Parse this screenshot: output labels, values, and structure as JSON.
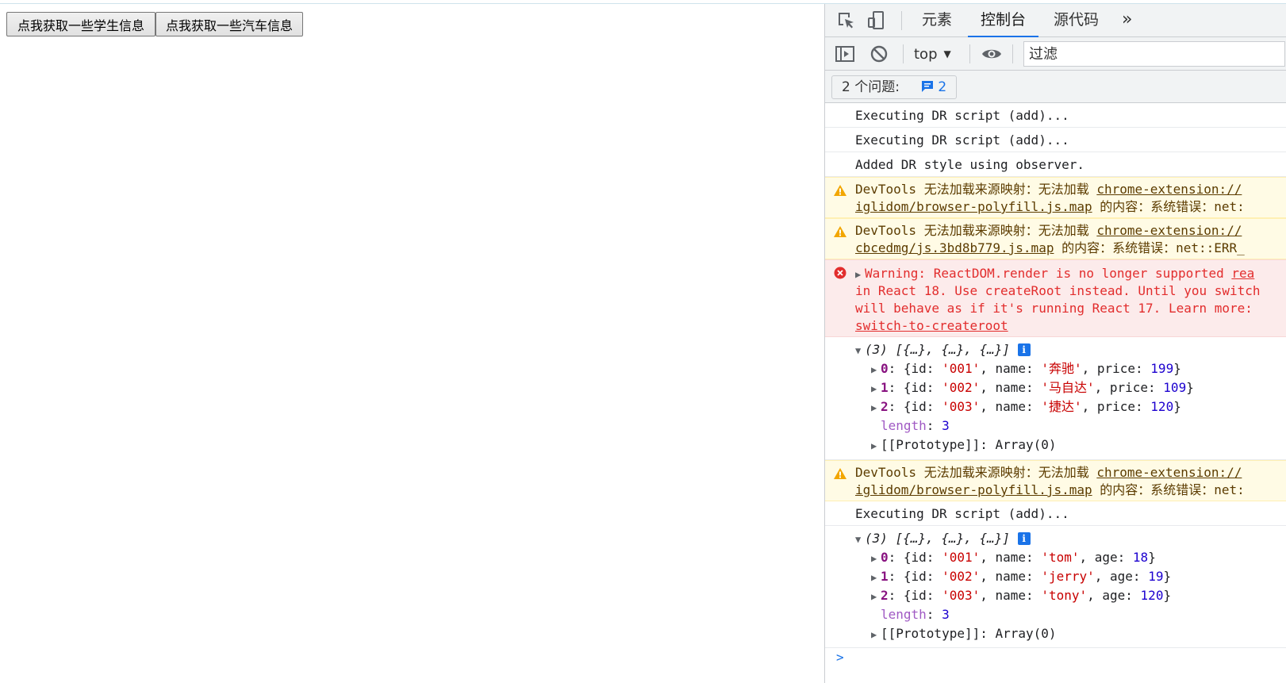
{
  "page": {
    "buttons": [
      "点我获取一些学生信息",
      "点我获取一些汽车信息"
    ]
  },
  "devtools": {
    "tabs": [
      {
        "label": "元素",
        "active": false
      },
      {
        "label": "控制台",
        "active": true
      },
      {
        "label": "源代码",
        "active": false
      }
    ],
    "more_tabs": "»",
    "context": "top",
    "filter_placeholder": "过滤",
    "issues_label": "2 个问题:",
    "issues_count": "2",
    "messages": [
      {
        "type": "log",
        "text": "Executing DR script (add)..."
      },
      {
        "type": "log",
        "text": "Executing DR script (add)..."
      },
      {
        "type": "log",
        "text": "Added DR style using observer."
      },
      {
        "type": "warn",
        "prefix": "DevTools 无法加载来源映射：无法加载 ",
        "link": "chrome-extension://",
        "link2": "iglidom/browser-polyfill.js.map",
        "suffix": " 的内容：系统错误：net:"
      },
      {
        "type": "warn",
        "prefix": "DevTools 无法加载来源映射：无法加载 ",
        "link": "chrome-extension://",
        "link2": "cbcedmg/js.3bd8b779.js.map",
        "suffix": " 的内容：系统错误：net::ERR_"
      },
      {
        "type": "error",
        "lines": [
          "Warning: ReactDOM.render is no longer supported ",
          "in React 18. Use createRoot instead. Until you switch",
          "will behave as if it's running React 17. Learn more:"
        ],
        "link_right": "rea",
        "link_bottom": "switch-to-createroot"
      },
      {
        "type": "warn",
        "prefix": "DevTools 无法加载来源映射：无法加载 ",
        "link": "chrome-extension://",
        "link2": "iglidom/browser-polyfill.js.map",
        "suffix": " 的内容：系统错误：net:"
      },
      {
        "type": "log",
        "text": "Executing DR script (add)..."
      }
    ],
    "arrays": [
      {
        "head": "(3) [{…}, {…}, {…}]",
        "items": [
          {
            "idx": "0",
            "id": "'001'",
            "name": "'奔驰'",
            "extra_key": "price",
            "extra_val": "199"
          },
          {
            "idx": "1",
            "id": "'002'",
            "name": "'马自达'",
            "extra_key": "price",
            "extra_val": "109"
          },
          {
            "idx": "2",
            "id": "'003'",
            "name": "'捷达'",
            "extra_key": "price",
            "extra_val": "120"
          }
        ],
        "length": "3",
        "proto": "[[Prototype]]: Array(0)"
      },
      {
        "head": "(3) [{…}, {…}, {…}]",
        "items": [
          {
            "idx": "0",
            "id": "'001'",
            "name": "'tom'",
            "extra_key": "age",
            "extra_val": "18"
          },
          {
            "idx": "1",
            "id": "'002'",
            "name": "'jerry'",
            "extra_key": "age",
            "extra_val": "19"
          },
          {
            "idx": "2",
            "id": "'003'",
            "name": "'tony'",
            "extra_key": "age",
            "extra_val": "120"
          }
        ],
        "length": "3",
        "proto": "[[Prototype]]: Array(0)"
      }
    ],
    "prompt": ">"
  },
  "icons": {
    "inspect": "inspect-element-icon",
    "device": "device-toolbar-icon",
    "sidebar": "show-sidebar-icon",
    "clear": "clear-console-icon",
    "eye": "live-expression-icon",
    "warning": "warning-icon",
    "error": "error-icon",
    "info": "info-icon",
    "issues": "issues-icon"
  },
  "colors": {
    "accent": "#1a73e8",
    "warn_bg": "#fffbe5",
    "error_bg": "#fcebeb",
    "error_text": "#e22d2d"
  }
}
